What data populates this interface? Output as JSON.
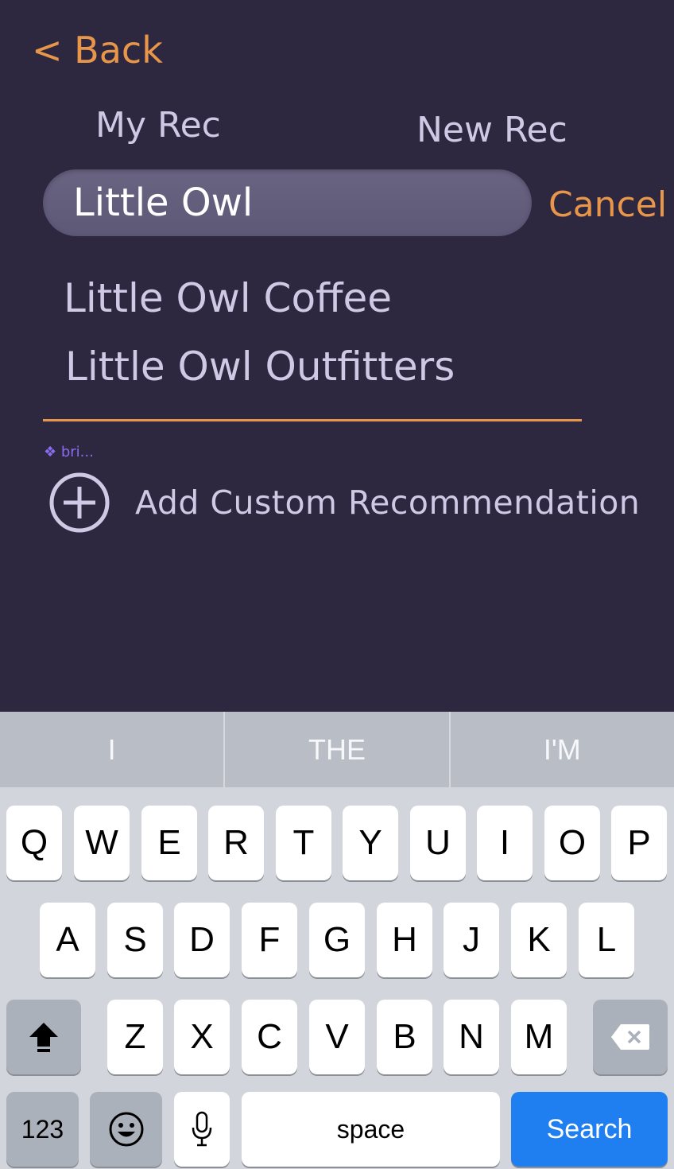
{
  "nav": {
    "back_label": "< Back"
  },
  "tabs": {
    "my_rec": "My Rec",
    "new_rec": "New Rec"
  },
  "search": {
    "value": "Little Owl",
    "cancel_label": "Cancel"
  },
  "suggestions": [
    "Little Owl Coffee",
    "Little Owl Outfitters"
  ],
  "badge": {
    "text": "❖ bri..."
  },
  "add_custom": {
    "label": "Add Custom Recommendation",
    "icon": "plus-circle-icon"
  },
  "colors": {
    "background": "#2d273f",
    "accent": "#e8964a",
    "text": "#cfc9e6",
    "search_key": "#1f7ff0"
  },
  "keyboard": {
    "predictions": [
      "I",
      "THE",
      "I'M"
    ],
    "row1": [
      "Q",
      "W",
      "E",
      "R",
      "T",
      "Y",
      "U",
      "I",
      "O",
      "P"
    ],
    "row2": [
      "A",
      "S",
      "D",
      "F",
      "G",
      "H",
      "J",
      "K",
      "L"
    ],
    "row3": [
      "Z",
      "X",
      "C",
      "V",
      "B",
      "N",
      "M"
    ],
    "numbers_label": "123",
    "space_label": "space",
    "search_label": "Search",
    "shift_icon": "shift-icon",
    "delete_icon": "backspace-icon",
    "emoji_icon": "emoji-icon",
    "mic_icon": "microphone-icon"
  }
}
